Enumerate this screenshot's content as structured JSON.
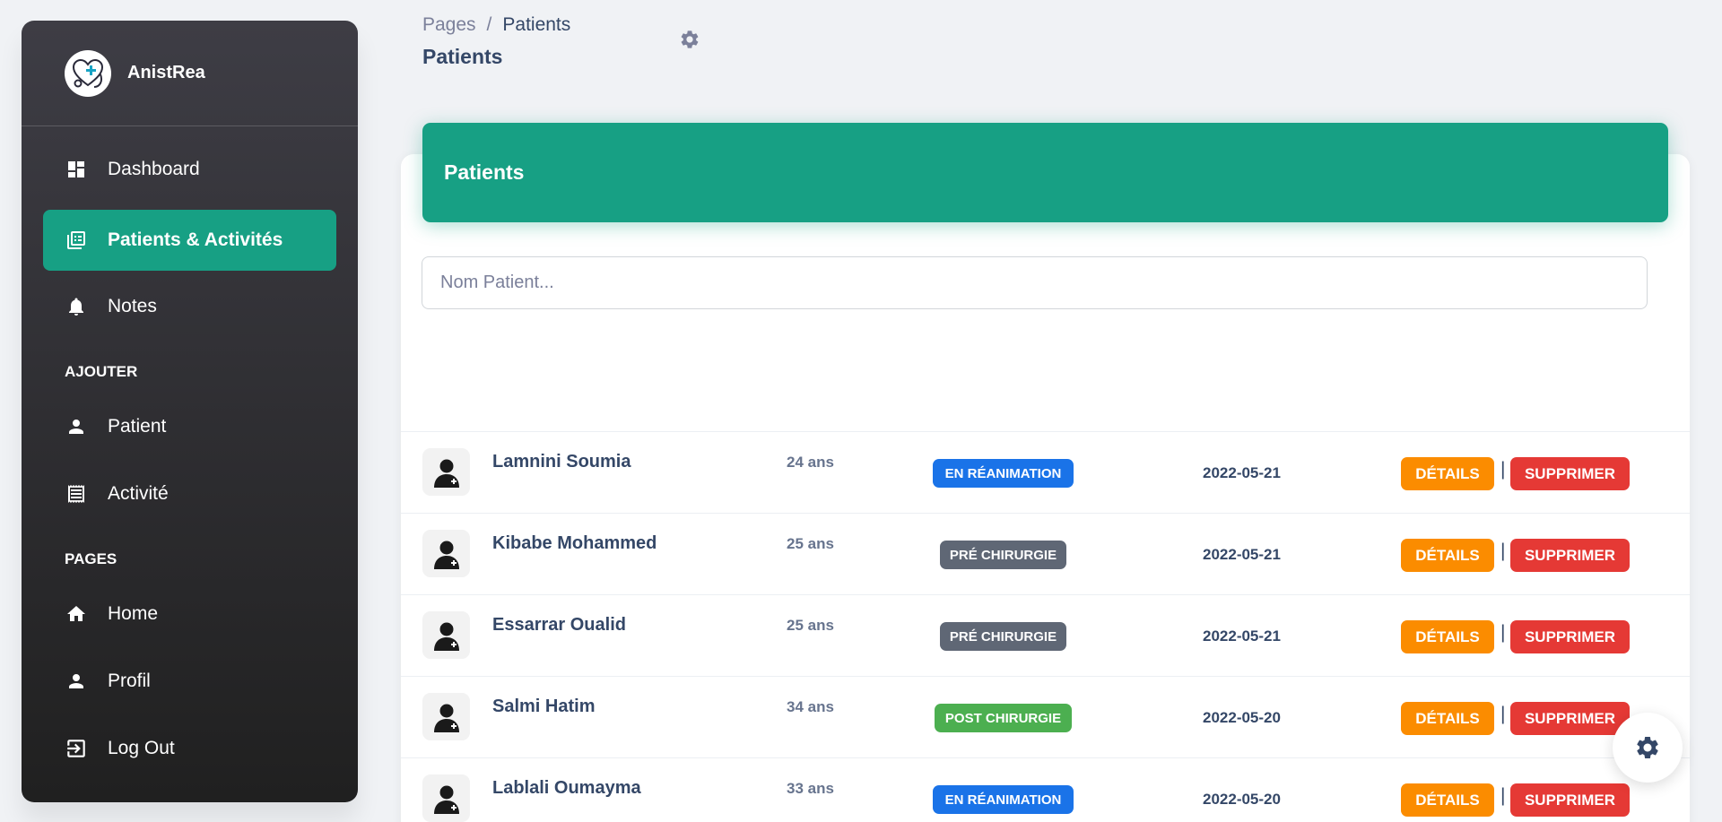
{
  "brand": {
    "name": "AnistRea",
    "logo_icon": "heart-stethoscope-icon"
  },
  "sidebar": {
    "items": [
      {
        "label": "Dashboard",
        "icon": "dashboard-icon"
      },
      {
        "label": "Patients & Activités",
        "icon": "patients-activities-icon",
        "active": true
      },
      {
        "label": "Notes",
        "icon": "bell-icon"
      }
    ],
    "section_add": "AJOUTER",
    "add_items": [
      {
        "label": "Patient",
        "icon": "person-icon"
      },
      {
        "label": "Activité",
        "icon": "receipt-icon"
      }
    ],
    "section_pages": "PAGES",
    "page_items": [
      {
        "label": "Home",
        "icon": "home-icon"
      },
      {
        "label": "Profil",
        "icon": "person-icon"
      },
      {
        "label": "Log Out",
        "icon": "logout-icon"
      }
    ]
  },
  "header": {
    "breadcrumb_root": "Pages",
    "breadcrumb_sep": "/",
    "breadcrumb_current": "Patients",
    "title": "Patients"
  },
  "card": {
    "title": "Patients",
    "search_placeholder": "Nom Patient..."
  },
  "patients": [
    {
      "name": "Lamnini Soumia",
      "age": "24 ans",
      "status": "EN RÉANIMATION",
      "status_color": "#1A73E8",
      "date": "2022-05-21"
    },
    {
      "name": "Kibabe Mohammed",
      "age": "25 ans",
      "status": "PRÉ CHIRURGIE",
      "status_color": "#5F6775",
      "date": "2022-05-21"
    },
    {
      "name": "Essarrar Oualid",
      "age": "25 ans",
      "status": "PRÉ CHIRURGIE",
      "status_color": "#5F6775",
      "date": "2022-05-21"
    },
    {
      "name": "Salmi Hatim",
      "age": "34 ans",
      "status": "POST CHIRURGIE",
      "status_color": "#4CAF50",
      "date": "2022-05-20"
    },
    {
      "name": "Lablali Oumayma",
      "age": "33 ans",
      "status": "EN RÉANIMATION",
      "status_color": "#1A73E8",
      "date": "2022-05-20"
    }
  ],
  "actions": {
    "details": "DÉTAILS",
    "delete": "SUPPRIMER",
    "separator": "|"
  },
  "colors": {
    "accent": "#17A084",
    "details": "#FB8C00",
    "delete": "#E53935"
  }
}
